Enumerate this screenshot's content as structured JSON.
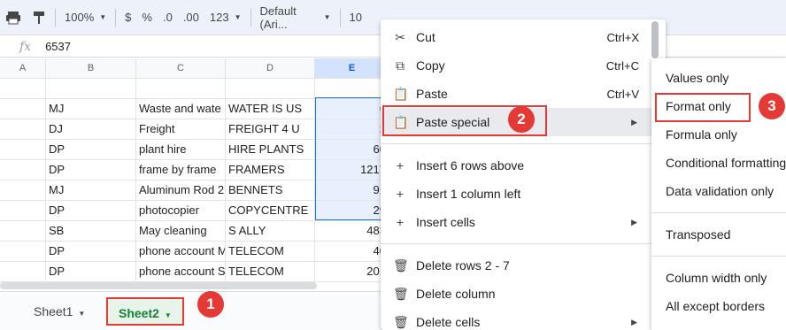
{
  "toolbar": {
    "zoom": "100%",
    "currency": "$",
    "percent": "%",
    "dec_decrease": ".0",
    "dec_increase": ".00",
    "more_formats": "123",
    "font": "Default (Ari...",
    "font_size": "10"
  },
  "formula_bar": {
    "fx_label": "fx",
    "value": "6537"
  },
  "columns": [
    "A",
    "B",
    "C",
    "D",
    "E"
  ],
  "rows": [
    {
      "a": "",
      "b": "",
      "c": "",
      "d": "",
      "e": ""
    },
    {
      "a": "",
      "b": "MJ",
      "c": "Waste and wate",
      "d": "WATER IS US",
      "e": "6"
    },
    {
      "a": "",
      "b": "DJ",
      "c": "Freight",
      "d": "FREIGHT 4 U",
      "e": "2"
    },
    {
      "a": "",
      "b": "DP",
      "c": "plant hire",
      "d": "HIRE PLANTS",
      "e": "60"
    },
    {
      "a": "",
      "b": "DP",
      "c": "frame by frame",
      "d": "FRAMERS",
      "e": "1217"
    },
    {
      "a": "",
      "b": "MJ",
      "c": "Aluminum Rod 2",
      "d": "BENNETS",
      "e": "91"
    },
    {
      "a": "",
      "b": "DP",
      "c": "photocopier",
      "d": "COPYCENTRE",
      "e": "29"
    },
    {
      "a": "",
      "b": "SB",
      "c": "May cleaning",
      "d": "S ALLY",
      "e": "483"
    },
    {
      "a": "",
      "b": "DP",
      "c": "phone account M",
      "d": "TELECOM",
      "e": "40"
    },
    {
      "a": "",
      "b": "DP",
      "c": "phone account S",
      "d": "TELECOM",
      "e": "201"
    }
  ],
  "sheets": [
    "Sheet1",
    "Sheet2"
  ],
  "context_menu": {
    "cut": {
      "label": "Cut",
      "shortcut": "Ctrl+X"
    },
    "copy": {
      "label": "Copy",
      "shortcut": "Ctrl+C"
    },
    "paste": {
      "label": "Paste",
      "shortcut": "Ctrl+V"
    },
    "paste_special": {
      "label": "Paste special"
    },
    "insert_rows": {
      "label": "Insert 6 rows above"
    },
    "insert_column": {
      "label": "Insert 1 column left"
    },
    "insert_cells": {
      "label": "Insert cells"
    },
    "delete_rows": {
      "label": "Delete rows 2 - 7"
    },
    "delete_column": {
      "label": "Delete column"
    },
    "delete_cells": {
      "label": "Delete cells"
    }
  },
  "paste_special_menu": [
    "Values only",
    "Format only",
    "Formula only",
    "Conditional formatting only",
    "Data validation only",
    "Transposed",
    "Column width only",
    "All except borders"
  ],
  "badges": [
    "1",
    "2",
    "3"
  ],
  "colors": {
    "annotation_red": "#e53935",
    "active_tab_green": "#188038",
    "selection_blue": "#1a73e8"
  }
}
